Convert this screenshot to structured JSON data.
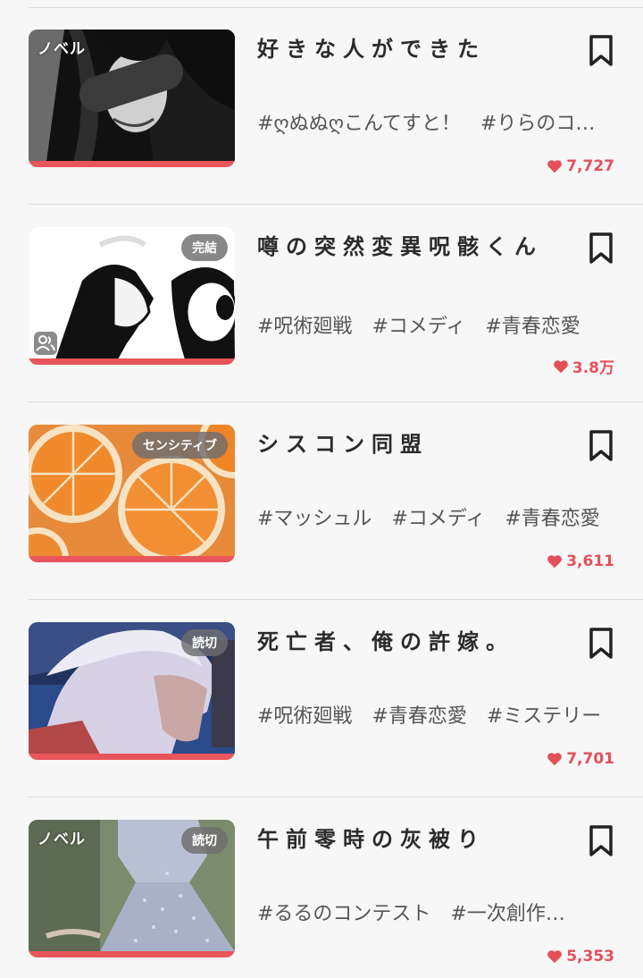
{
  "items": [
    {
      "title": "好きな人ができた",
      "tags": [
        "#ღぬぬღこんてすと！",
        "#りらのコ…"
      ],
      "likes": "7,727",
      "badge_left": "ノベル",
      "badge_right": ""
    },
    {
      "title": "噂の突然変異呪骸くん",
      "tags": [
        "#呪術廻戦",
        "#コメディ",
        "#青春恋愛"
      ],
      "likes": "3.8万",
      "badge_left": "",
      "badge_right": "完結"
    },
    {
      "title": "シスコン同盟",
      "tags": [
        "#マッシュル",
        "#コメディ",
        "#青春恋愛"
      ],
      "likes": "3,611",
      "badge_left": "",
      "badge_right": "センシティブ"
    },
    {
      "title": "死亡者、俺の許嫁。",
      "tags": [
        "#呪術廻戦",
        "#青春恋愛",
        "#ミステリー"
      ],
      "likes": "7,701",
      "badge_left": "",
      "badge_right": "読切"
    },
    {
      "title": "午前零時の灰被り",
      "tags": [
        "#るるのコンテスト",
        "#一次創作…"
      ],
      "likes": "5,353",
      "badge_left": "ノベル",
      "badge_right": "読切"
    }
  ],
  "colors": {
    "accent": "#e8555b",
    "like": "#e4505a",
    "title": "#2b2b2b",
    "tag": "#555555",
    "background": "#f7f7f7"
  },
  "icons": [
    "bookmark-icon",
    "heart-icon",
    "people-icon"
  ]
}
